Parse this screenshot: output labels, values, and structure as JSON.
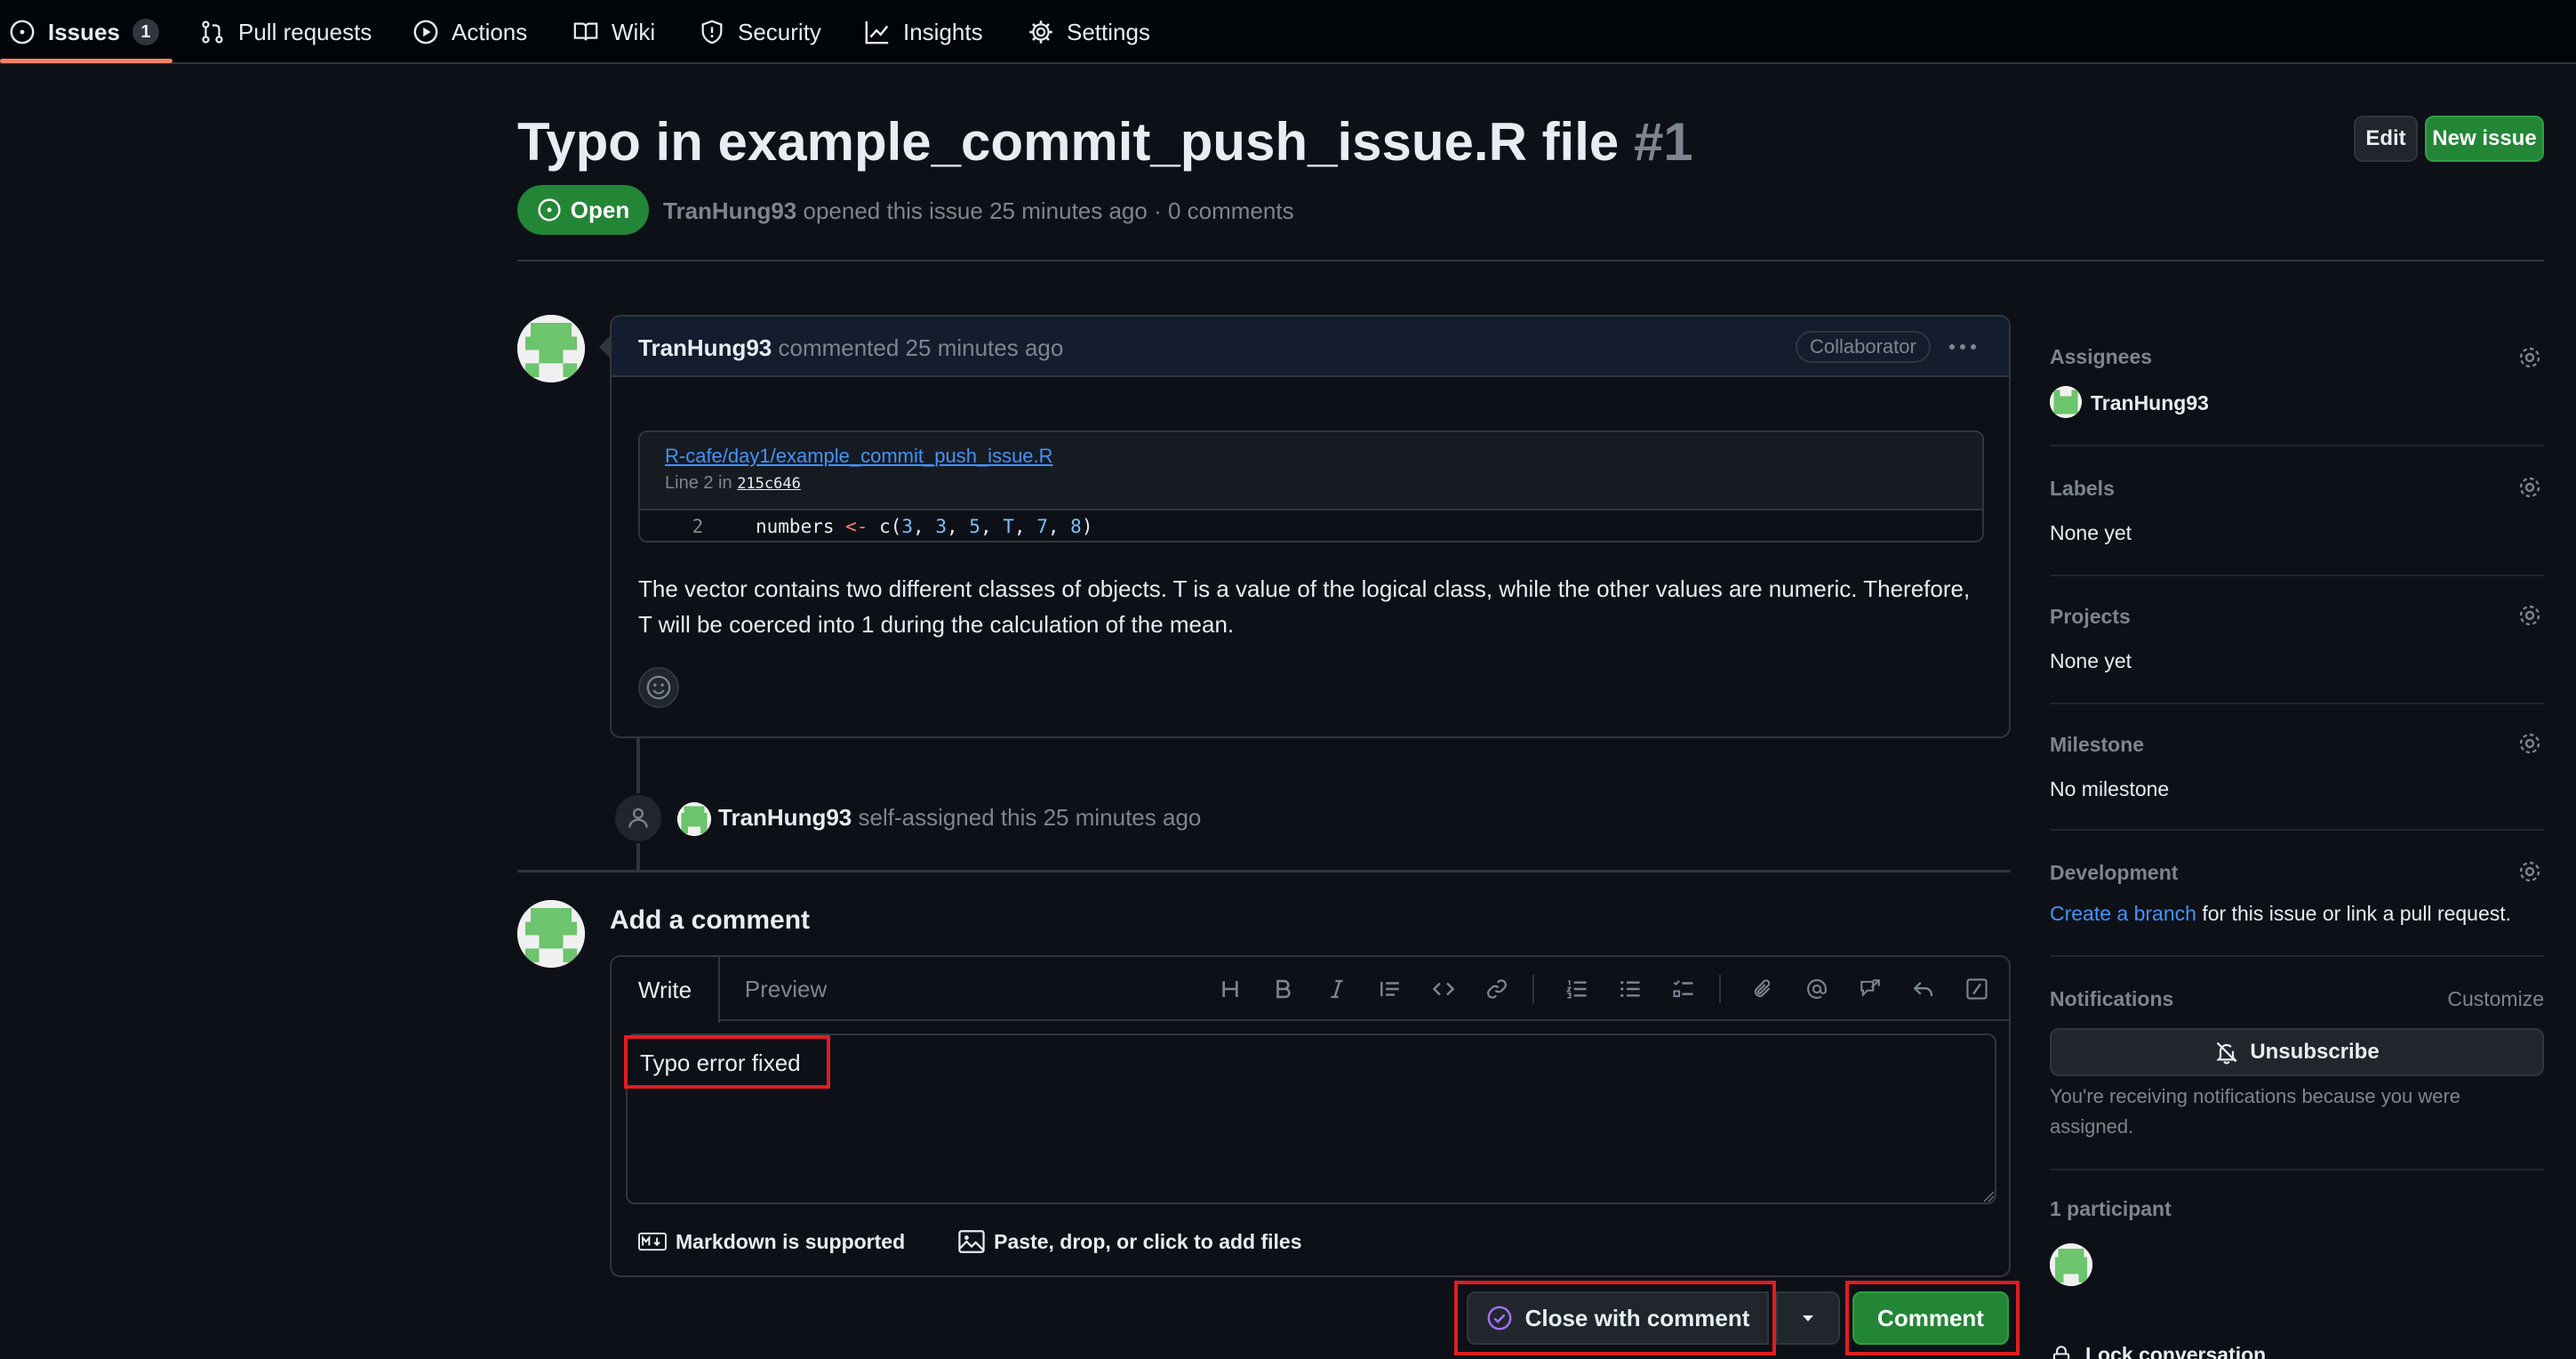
{
  "nav": {
    "items": [
      {
        "label": "Issues",
        "count": "1",
        "icon": "issue-opened-icon"
      },
      {
        "label": "Pull requests",
        "icon": "git-pull-request-icon"
      },
      {
        "label": "Actions",
        "icon": "play-icon"
      },
      {
        "label": "Wiki",
        "icon": "book-icon"
      },
      {
        "label": "Security",
        "icon": "shield-icon"
      },
      {
        "label": "Insights",
        "icon": "graph-icon"
      },
      {
        "label": "Settings",
        "icon": "gear-icon"
      }
    ]
  },
  "header": {
    "title": "Typo in example_commit_push_issue.R file",
    "number": "#1",
    "edit_label": "Edit",
    "new_issue_label": "New issue",
    "state": "Open",
    "author": "TranHung93",
    "meta_text": "opened this issue 25 minutes ago · 0 comments"
  },
  "comment": {
    "author": "TranHung93",
    "action": "commented 25 minutes ago",
    "role": "Collaborator",
    "snippet": {
      "path": "R-cafe/day1/example_commit_push_issue.R",
      "line_prefix": "Line 2 in",
      "commit": "215c646",
      "line_number": "2",
      "code": {
        "var": "numbers ",
        "op": "<-",
        "fn": " c(",
        "n1": "3",
        "s1": ", ",
        "n2": "3",
        "s2": ", ",
        "n3": "5",
        "s3": ", ",
        "n4": "T",
        "s4": ", ",
        "n5": "7",
        "s5": ", ",
        "n6": "8",
        "close": ")"
      }
    },
    "body": "The vector contains two different classes of objects. T is a value of the logical class, while the other values are numeric. Therefore, T will be coerced into 1 during the calculation of the mean."
  },
  "timeline": {
    "actor": "TranHung93",
    "event": "self-assigned this 25 minutes ago"
  },
  "add_comment": {
    "title": "Add a comment",
    "tab_write": "Write",
    "tab_preview": "Preview",
    "text": "Typo error fixed",
    "markdown_hint": "Markdown is supported",
    "files_hint": "Paste, drop, or click to add files",
    "close_label": "Close with comment",
    "comment_label": "Comment"
  },
  "sidebar": {
    "assignees_title": "Assignees",
    "assignee": "TranHung93",
    "labels_title": "Labels",
    "labels_value": "None yet",
    "projects_title": "Projects",
    "projects_value": "None yet",
    "milestone_title": "Milestone",
    "milestone_value": "No milestone",
    "development_title": "Development",
    "development_link": "Create a branch",
    "development_text": " for this issue or link a pull request.",
    "notifications_title": "Notifications",
    "customize": "Customize",
    "unsubscribe": "Unsubscribe",
    "notif_reason": "You're receiving notifications because you were assigned.",
    "participants": "1 participant",
    "lock": "Lock conversation"
  },
  "colors": {
    "accent_green": "#238636",
    "link_blue": "#4493f8",
    "highlight_red": "#e11d21",
    "nav_underline": "#f78166"
  }
}
